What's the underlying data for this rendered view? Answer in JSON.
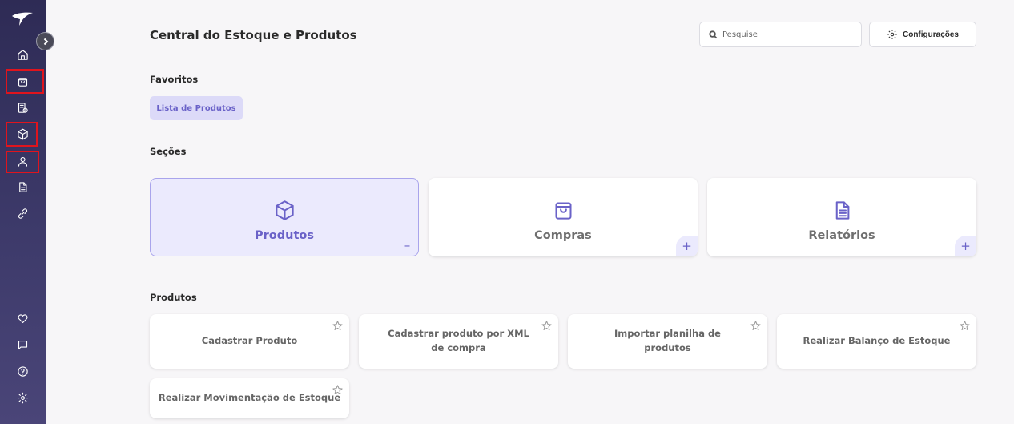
{
  "page": {
    "title": "Central do Estoque e Produtos"
  },
  "search": {
    "placeholder": "Pesquise",
    "icon": "search-icon"
  },
  "config_button": {
    "label": "Configurações",
    "icon": "gear-icon"
  },
  "favorites": {
    "heading": "Favoritos",
    "items": [
      {
        "label": "Lista de Produtos"
      }
    ]
  },
  "sections": {
    "heading": "Seções",
    "cards": [
      {
        "label": "Produtos",
        "icon": "box-icon",
        "active": true,
        "toggle": "–"
      },
      {
        "label": "Compras",
        "icon": "shopping-bag-icon",
        "active": false,
        "toggle": "+"
      },
      {
        "label": "Relatórios",
        "icon": "document-icon",
        "active": false,
        "toggle": "+"
      }
    ]
  },
  "products": {
    "heading": "Produtos",
    "items": [
      {
        "label": "Cadastrar Produto"
      },
      {
        "label": "Cadastrar produto por XML de compra"
      },
      {
        "label": "Importar planilha de produtos"
      },
      {
        "label": "Realizar Balanço de Estoque"
      },
      {
        "label": "Realizar Movimentação de Estoque"
      }
    ]
  },
  "sidebar": {
    "items": [
      {
        "icon": "home-icon",
        "highlighted": false
      },
      {
        "icon": "shopping-bag-icon",
        "highlighted": true
      },
      {
        "icon": "finance-icon",
        "highlighted": false
      },
      {
        "icon": "box-icon",
        "highlighted": true
      },
      {
        "icon": "user-icon",
        "highlighted": true
      },
      {
        "icon": "document-icon",
        "highlighted": false
      },
      {
        "icon": "link-icon",
        "highlighted": false
      },
      {
        "icon": "heart-icon",
        "highlighted": false
      },
      {
        "icon": "chat-icon",
        "highlighted": false
      },
      {
        "icon": "help-icon",
        "highlighted": false
      },
      {
        "icon": "gear-icon",
        "highlighted": false
      }
    ]
  },
  "colors": {
    "accent": "#6a62c8",
    "sidebar": "#2e2b55",
    "highlight": "#e0141d",
    "active_card_bg": "#ebeafd"
  }
}
